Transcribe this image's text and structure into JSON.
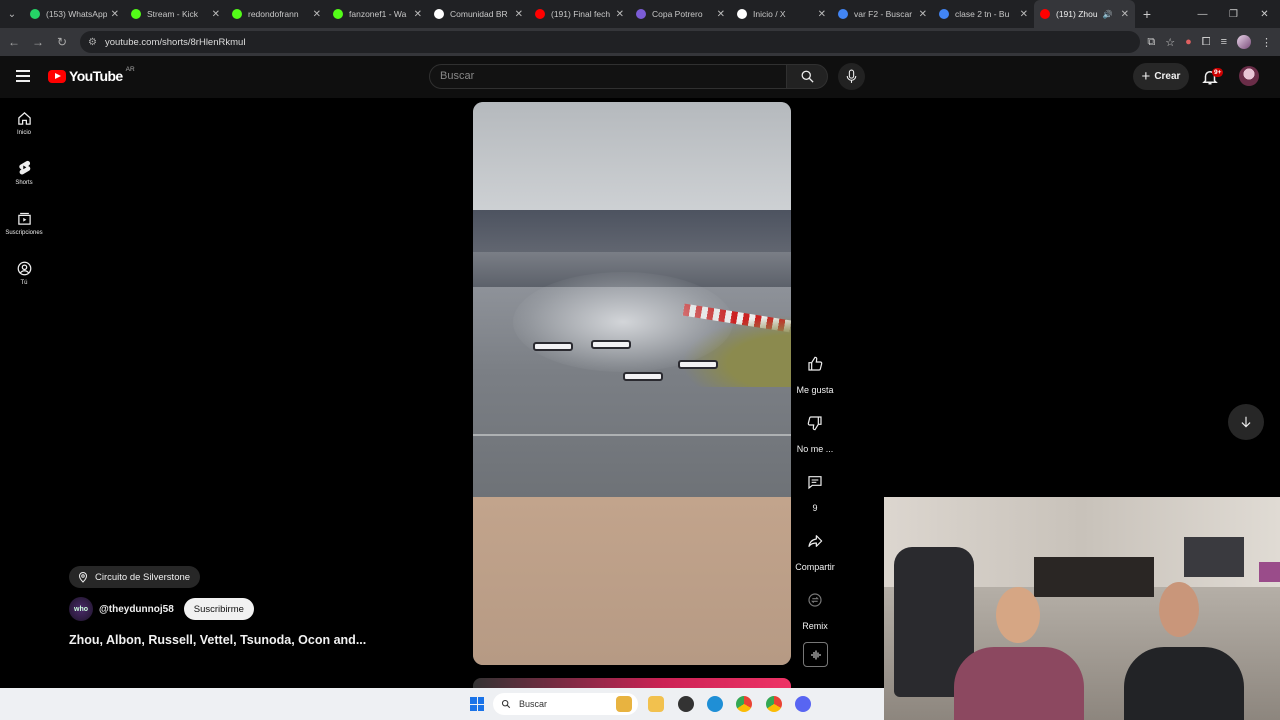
{
  "browser": {
    "tabs": [
      {
        "label": "(153) WhatsApp",
        "favicon_color": "#25d366",
        "icon": "whatsapp-icon"
      },
      {
        "label": "Stream - Kick",
        "favicon_color": "#53fc18",
        "icon": "kick-icon"
      },
      {
        "label": "redondofrann",
        "favicon_color": "#53fc18",
        "icon": "kick-icon"
      },
      {
        "label": "fanzonef1 - Wa",
        "favicon_color": "#53fc18",
        "icon": "kick-icon"
      },
      {
        "label": "Comunidad BR",
        "favicon_color": "#ffffff",
        "icon": "x-icon"
      },
      {
        "label": "(191) Final fech",
        "favicon_color": "#ff0000",
        "icon": "youtube-icon"
      },
      {
        "label": "Copa Potrero",
        "favicon_color": "#7b5cd6",
        "icon": "shield-icon"
      },
      {
        "label": "Inicio / X",
        "favicon_color": "#ffffff",
        "icon": "x-icon"
      },
      {
        "label": "var F2 - Buscar",
        "favicon_color": "#4285f4",
        "icon": "google-icon"
      },
      {
        "label": "clase 2 tn - Bu",
        "favicon_color": "#4285f4",
        "icon": "google-icon"
      },
      {
        "label": "(191) Zhou",
        "favicon_color": "#ff0000",
        "icon": "youtube-icon",
        "active": true
      }
    ],
    "url": "youtube.com/shorts/8rHlenRkmuI"
  },
  "youtube": {
    "country_code": "AR",
    "logo_text": "YouTube",
    "search_placeholder": "Buscar",
    "create_label": "Crear",
    "notifications_badge": "9+",
    "sidebar": [
      {
        "label": "Inicio",
        "icon": "home-icon"
      },
      {
        "label": "Shorts",
        "icon": "shorts-icon"
      },
      {
        "label": "Suscripciones",
        "icon": "subscriptions-icon"
      },
      {
        "label": "Tú",
        "icon": "user-circle-icon"
      }
    ],
    "actions": [
      {
        "label": "Me gusta",
        "icon": "thumbs-up-icon"
      },
      {
        "label": "No me ...",
        "icon": "thumbs-down-icon"
      },
      {
        "label": "9",
        "icon": "comment-icon"
      },
      {
        "label": "Compartir",
        "icon": "share-icon"
      },
      {
        "label": "Remix",
        "icon": "remix-icon"
      }
    ],
    "short": {
      "location": "Circuito de Silverstone",
      "channel": "@theydunnoj58",
      "channel_avatar_text": "who",
      "subscribe_label": "Suscribirme",
      "title": "Zhou, Albon, Russell, Vettel, Tsunoda, Ocon and..."
    }
  },
  "taskbar": {
    "search_placeholder": "Buscar"
  }
}
